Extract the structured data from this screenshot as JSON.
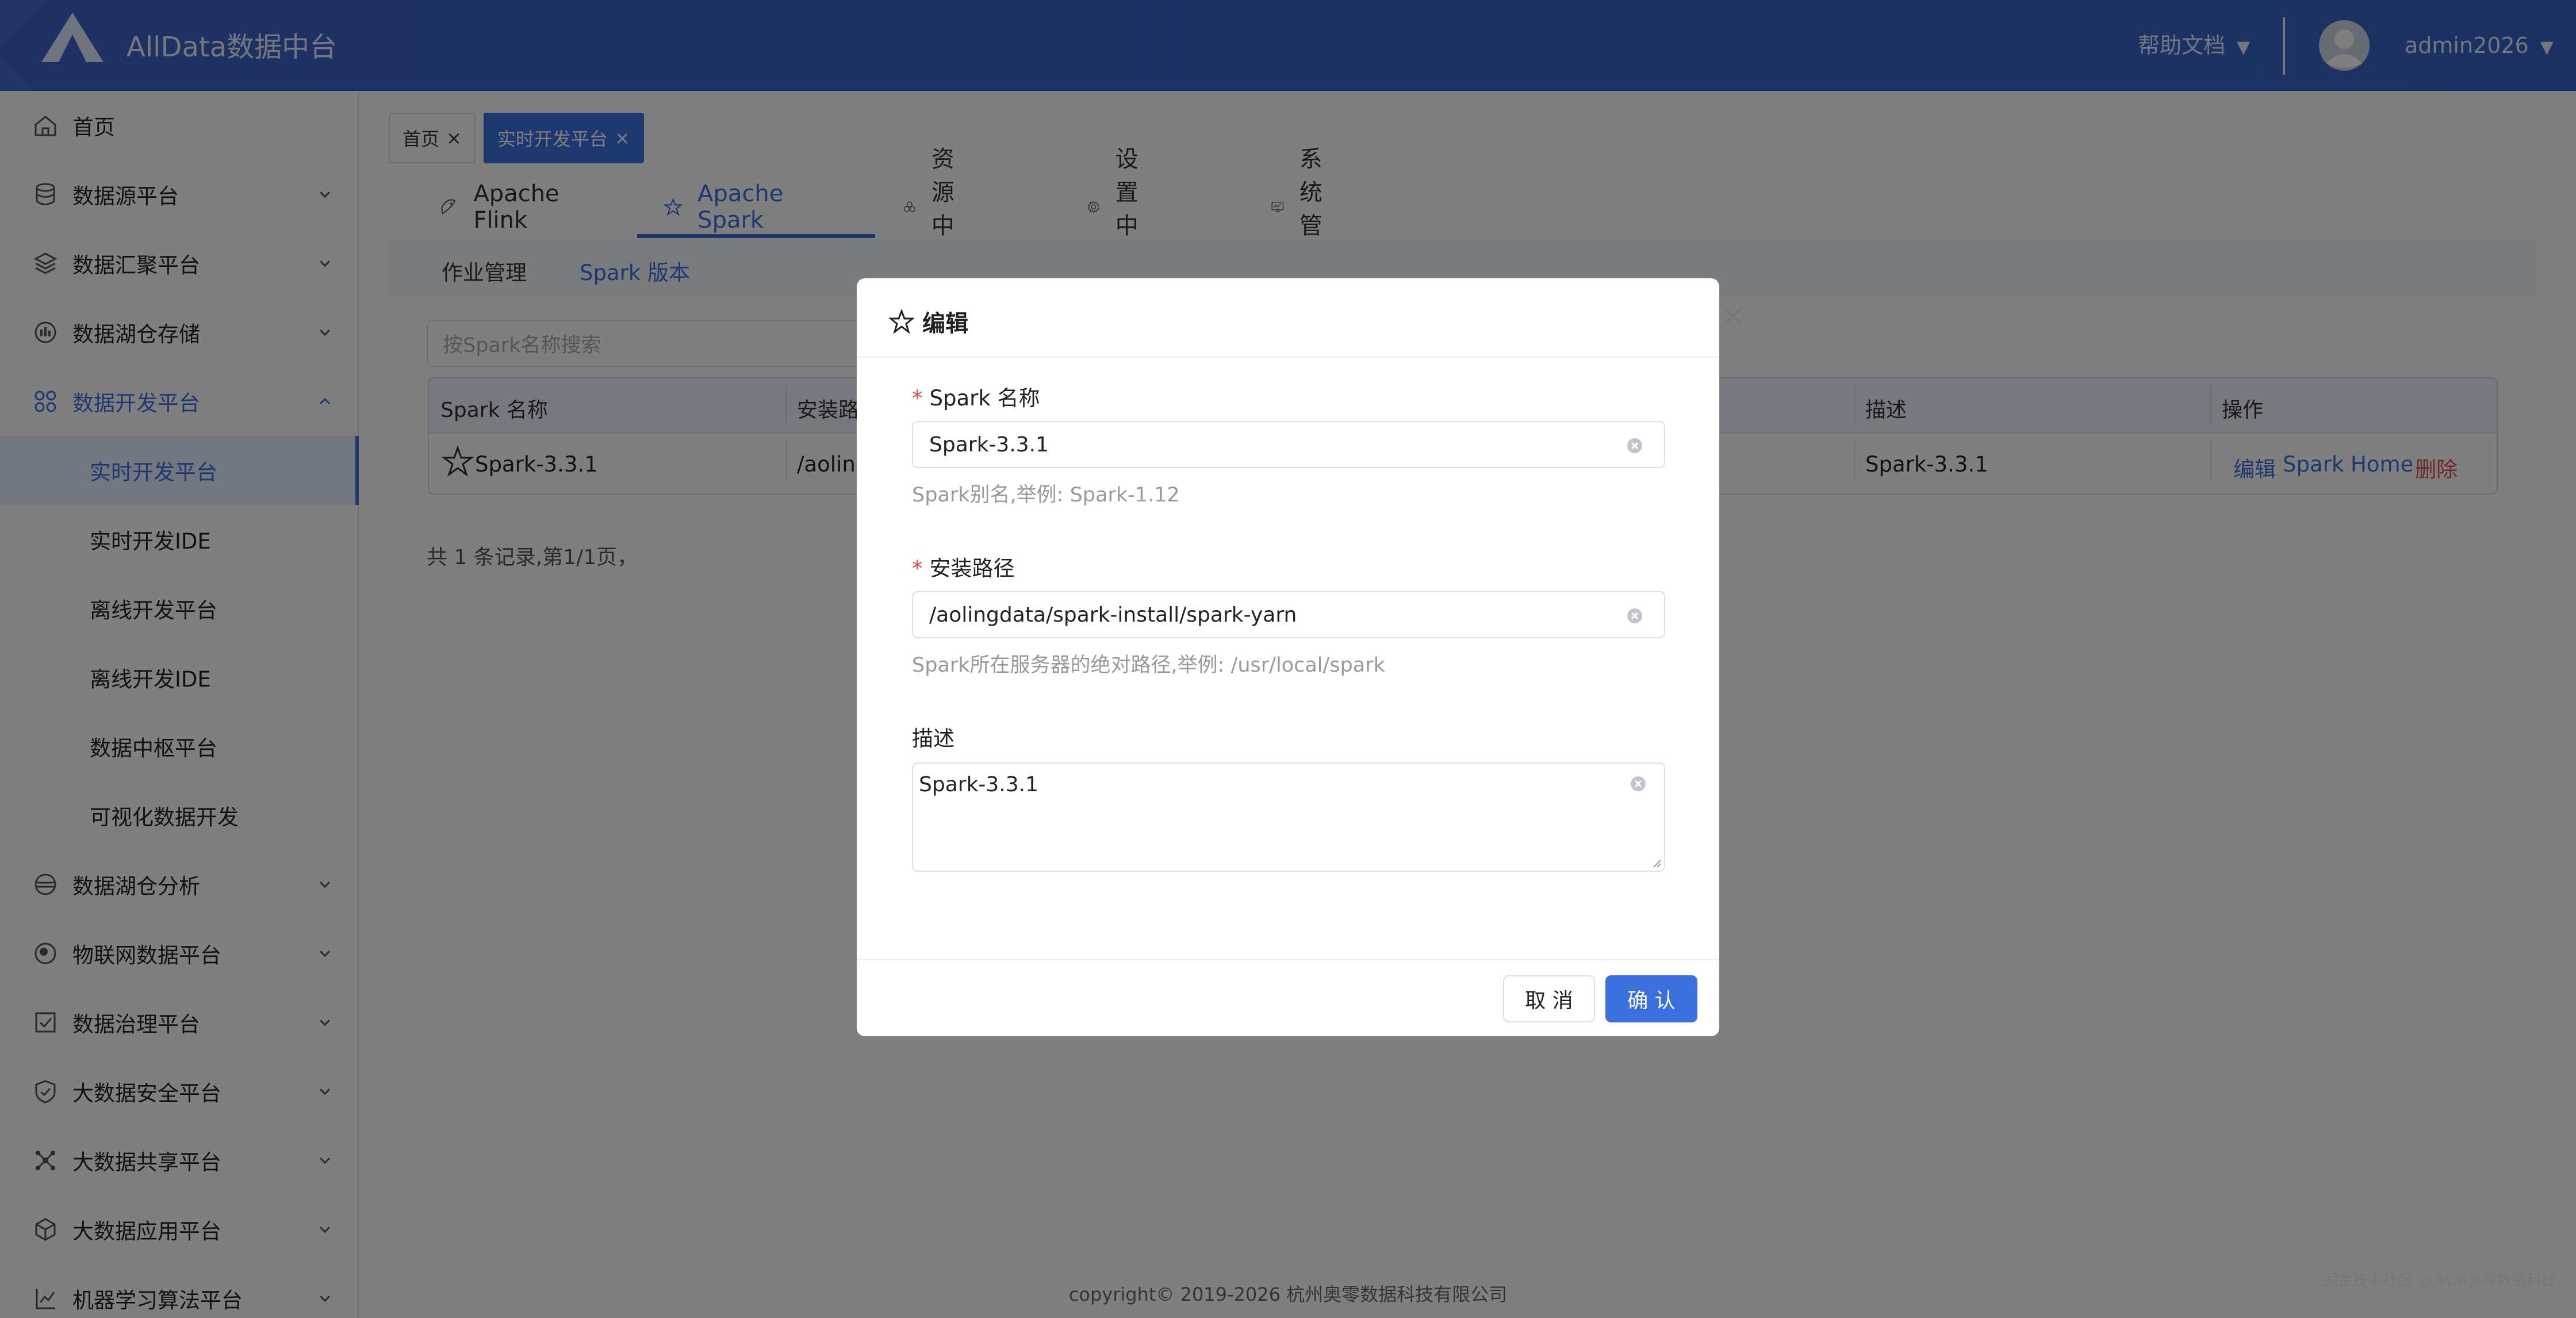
{
  "header": {
    "app_title": "AllData数据中台",
    "help_label": "帮助文档",
    "user_name": "admin2026",
    "dropdown_arrow": "▼"
  },
  "sidebar": {
    "items": [
      {
        "label": "首页",
        "icon": "home-icon"
      },
      {
        "label": "数据源平台",
        "icon": "database-icon"
      },
      {
        "label": "数据汇聚平台",
        "icon": "layers-icon"
      },
      {
        "label": "数据湖仓存储",
        "icon": "storage-icon"
      },
      {
        "label": "数据开发平台",
        "icon": "grid-icon"
      },
      {
        "label": "数据湖仓分析",
        "icon": "analysis-icon"
      },
      {
        "label": "物联网数据平台",
        "icon": "iot-icon"
      },
      {
        "label": "数据治理平台",
        "icon": "governance-icon"
      },
      {
        "label": "大数据安全平台",
        "icon": "shield-icon"
      },
      {
        "label": "大数据共享平台",
        "icon": "share-icon"
      },
      {
        "label": "大数据应用平台",
        "icon": "cube-icon"
      },
      {
        "label": "机器学习算法平台",
        "icon": "ml-icon"
      }
    ],
    "sub_items": [
      {
        "label": "实时开发平台"
      },
      {
        "label": "实时开发IDE"
      },
      {
        "label": "离线开发平台"
      },
      {
        "label": "离线开发IDE"
      },
      {
        "label": "数据中枢平台"
      },
      {
        "label": "可视化数据开发"
      }
    ]
  },
  "tags": [
    {
      "label": "首页",
      "close": "×"
    },
    {
      "label": "实时开发平台",
      "close": "×"
    }
  ],
  "top_tabs": [
    {
      "label": "Apache Flink"
    },
    {
      "label": "Apache Spark"
    },
    {
      "label": "资源中心"
    },
    {
      "label": "设置中心"
    },
    {
      "label": "系统管理"
    }
  ],
  "sub_nav": [
    {
      "label": "作业管理"
    },
    {
      "label": "Spark 版本"
    }
  ],
  "search": {
    "placeholder": "按Spark名称搜索"
  },
  "table": {
    "headers": [
      "Spark 名称",
      "安装路",
      "描述",
      "操作"
    ],
    "rows": [
      {
        "name": "Spark-3.3.1",
        "path": "/aoling",
        "desc": "Spark-3.3.1",
        "edit": "编辑",
        "home": "Spark Home",
        "delete": "删除"
      }
    ]
  },
  "pager": {
    "summary": "共 1 条记录,第1/1页，"
  },
  "footer": {
    "copyright": "copyright© 2019-2026 杭州奥零数据科技有限公司"
  },
  "watermark": "掘金技术社区 @ 杭州奥零数据科技",
  "modal": {
    "title": "编辑",
    "fields": {
      "name_label": "Spark 名称",
      "name_value": "Spark-3.3.1",
      "name_hint": "Spark别名,举例: Spark-1.12",
      "path_label": "安装路径",
      "path_value": "/aolingdata/spark-install/spark-yarn",
      "path_hint": "Spark所在服务器的绝对路径,举例: /usr/local/spark",
      "desc_label": "描述",
      "desc_value": "Spark-3.3.1",
      "required_mark": "*"
    },
    "cancel_label": "取 消",
    "ok_label": "确 认"
  },
  "colors": {
    "primary": "#3b6fde",
    "header_bg": "#3a62c6",
    "danger": "#e04b4b"
  }
}
